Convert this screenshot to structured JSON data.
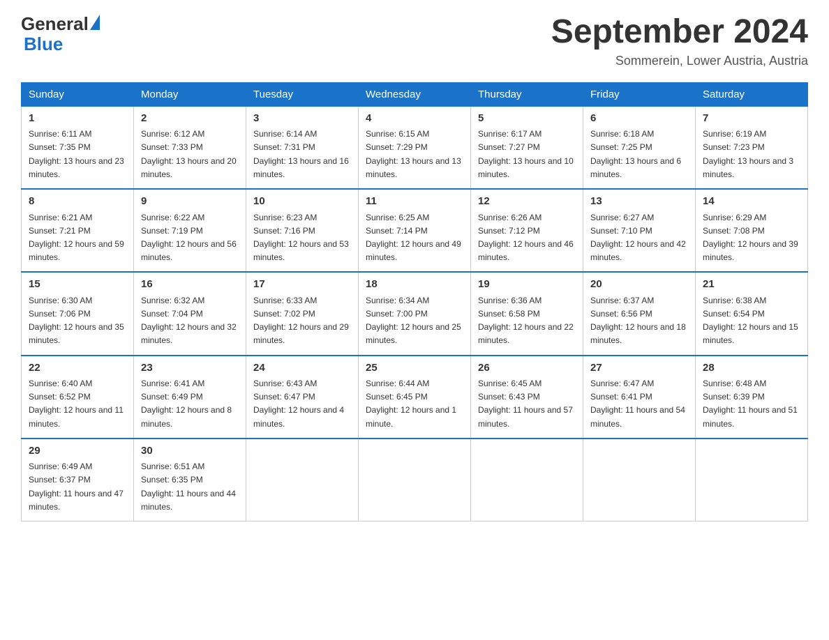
{
  "header": {
    "logo_general": "General",
    "logo_blue": "Blue",
    "title": "September 2024",
    "location": "Sommerein, Lower Austria, Austria"
  },
  "days_of_week": [
    "Sunday",
    "Monday",
    "Tuesday",
    "Wednesday",
    "Thursday",
    "Friday",
    "Saturday"
  ],
  "weeks": [
    [
      {
        "day": "1",
        "sunrise": "6:11 AM",
        "sunset": "7:35 PM",
        "daylight": "13 hours and 23 minutes."
      },
      {
        "day": "2",
        "sunrise": "6:12 AM",
        "sunset": "7:33 PM",
        "daylight": "13 hours and 20 minutes."
      },
      {
        "day": "3",
        "sunrise": "6:14 AM",
        "sunset": "7:31 PM",
        "daylight": "13 hours and 16 minutes."
      },
      {
        "day": "4",
        "sunrise": "6:15 AM",
        "sunset": "7:29 PM",
        "daylight": "13 hours and 13 minutes."
      },
      {
        "day": "5",
        "sunrise": "6:17 AM",
        "sunset": "7:27 PM",
        "daylight": "13 hours and 10 minutes."
      },
      {
        "day": "6",
        "sunrise": "6:18 AM",
        "sunset": "7:25 PM",
        "daylight": "13 hours and 6 minutes."
      },
      {
        "day": "7",
        "sunrise": "6:19 AM",
        "sunset": "7:23 PM",
        "daylight": "13 hours and 3 minutes."
      }
    ],
    [
      {
        "day": "8",
        "sunrise": "6:21 AM",
        "sunset": "7:21 PM",
        "daylight": "12 hours and 59 minutes."
      },
      {
        "day": "9",
        "sunrise": "6:22 AM",
        "sunset": "7:19 PM",
        "daylight": "12 hours and 56 minutes."
      },
      {
        "day": "10",
        "sunrise": "6:23 AM",
        "sunset": "7:16 PM",
        "daylight": "12 hours and 53 minutes."
      },
      {
        "day": "11",
        "sunrise": "6:25 AM",
        "sunset": "7:14 PM",
        "daylight": "12 hours and 49 minutes."
      },
      {
        "day": "12",
        "sunrise": "6:26 AM",
        "sunset": "7:12 PM",
        "daylight": "12 hours and 46 minutes."
      },
      {
        "day": "13",
        "sunrise": "6:27 AM",
        "sunset": "7:10 PM",
        "daylight": "12 hours and 42 minutes."
      },
      {
        "day": "14",
        "sunrise": "6:29 AM",
        "sunset": "7:08 PM",
        "daylight": "12 hours and 39 minutes."
      }
    ],
    [
      {
        "day": "15",
        "sunrise": "6:30 AM",
        "sunset": "7:06 PM",
        "daylight": "12 hours and 35 minutes."
      },
      {
        "day": "16",
        "sunrise": "6:32 AM",
        "sunset": "7:04 PM",
        "daylight": "12 hours and 32 minutes."
      },
      {
        "day": "17",
        "sunrise": "6:33 AM",
        "sunset": "7:02 PM",
        "daylight": "12 hours and 29 minutes."
      },
      {
        "day": "18",
        "sunrise": "6:34 AM",
        "sunset": "7:00 PM",
        "daylight": "12 hours and 25 minutes."
      },
      {
        "day": "19",
        "sunrise": "6:36 AM",
        "sunset": "6:58 PM",
        "daylight": "12 hours and 22 minutes."
      },
      {
        "day": "20",
        "sunrise": "6:37 AM",
        "sunset": "6:56 PM",
        "daylight": "12 hours and 18 minutes."
      },
      {
        "day": "21",
        "sunrise": "6:38 AM",
        "sunset": "6:54 PM",
        "daylight": "12 hours and 15 minutes."
      }
    ],
    [
      {
        "day": "22",
        "sunrise": "6:40 AM",
        "sunset": "6:52 PM",
        "daylight": "12 hours and 11 minutes."
      },
      {
        "day": "23",
        "sunrise": "6:41 AM",
        "sunset": "6:49 PM",
        "daylight": "12 hours and 8 minutes."
      },
      {
        "day": "24",
        "sunrise": "6:43 AM",
        "sunset": "6:47 PM",
        "daylight": "12 hours and 4 minutes."
      },
      {
        "day": "25",
        "sunrise": "6:44 AM",
        "sunset": "6:45 PM",
        "daylight": "12 hours and 1 minute."
      },
      {
        "day": "26",
        "sunrise": "6:45 AM",
        "sunset": "6:43 PM",
        "daylight": "11 hours and 57 minutes."
      },
      {
        "day": "27",
        "sunrise": "6:47 AM",
        "sunset": "6:41 PM",
        "daylight": "11 hours and 54 minutes."
      },
      {
        "day": "28",
        "sunrise": "6:48 AM",
        "sunset": "6:39 PM",
        "daylight": "11 hours and 51 minutes."
      }
    ],
    [
      {
        "day": "29",
        "sunrise": "6:49 AM",
        "sunset": "6:37 PM",
        "daylight": "11 hours and 47 minutes."
      },
      {
        "day": "30",
        "sunrise": "6:51 AM",
        "sunset": "6:35 PM",
        "daylight": "11 hours and 44 minutes."
      },
      null,
      null,
      null,
      null,
      null
    ]
  ]
}
